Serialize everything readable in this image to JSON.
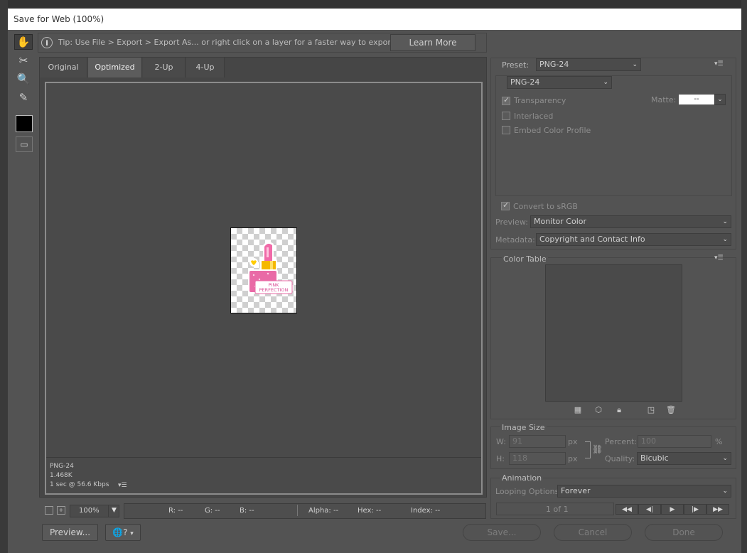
{
  "window": {
    "title": "Save for Web (100%)"
  },
  "tools": {
    "items": [
      {
        "name": "hand-tool-icon",
        "glyph": "✋"
      },
      {
        "name": "slice-select-tool-icon",
        "glyph": "✂"
      },
      {
        "name": "zoom-tool-icon",
        "glyph": "🔍"
      },
      {
        "name": "eyedropper-tool-icon",
        "glyph": "✎"
      }
    ],
    "color_swatch": "#000000",
    "slice_toggle_glyph": "▭"
  },
  "tip": {
    "text": "Tip: Use File > Export > Export As...  or right click on a layer for a faster way to export assets",
    "learn_more": "Learn More"
  },
  "tabs": [
    "Original",
    "Optimized",
    "2-Up",
    "4-Up"
  ],
  "preview_image": {
    "label_line1": "PINK",
    "label_line2": "PERFECTION"
  },
  "image_info": {
    "format": "PNG-24",
    "size": "1.468K",
    "speed": "1 sec @ 56.6 Kbps",
    "menu_glyph": "▾☰"
  },
  "statusbar": {
    "zoom": "100%",
    "r": "R: --",
    "g": "G: --",
    "b": "B: --",
    "alpha": "Alpha: --",
    "hex": "Hex: --",
    "index": "Index: --"
  },
  "footer": {
    "preview_label": "Preview...",
    "save_label": "Save...",
    "cancel_label": "Cancel",
    "done_label": "Done"
  },
  "settings": {
    "preset_label": "Preset:",
    "preset_value": "PNG-24",
    "format_value": "PNG-24",
    "transparency": "Transparency",
    "matte_label": "Matte:",
    "matte_value": "--",
    "interlaced": "Interlaced",
    "embed_profile": "Embed Color Profile",
    "convert_srgb": "Convert to sRGB",
    "preview_label": "Preview:",
    "preview_value": "Monitor Color",
    "metadata_label": "Metadata:",
    "metadata_value": "Copyright and Contact Info"
  },
  "color_table": {
    "title": "Color Table"
  },
  "image_size": {
    "title": "Image Size",
    "w_label": "W:",
    "w_value": "91",
    "w_unit": "px",
    "h_label": "H:",
    "h_value": "118",
    "h_unit": "px",
    "percent_label": "Percent:",
    "percent_value": "100",
    "percent_unit": "%",
    "quality_label": "Quality:",
    "quality_value": "Bicubic"
  },
  "animation": {
    "title": "Animation",
    "looping_label": "Looping Options:",
    "looping_value": "Forever",
    "frame_counter": "1 of 1"
  }
}
